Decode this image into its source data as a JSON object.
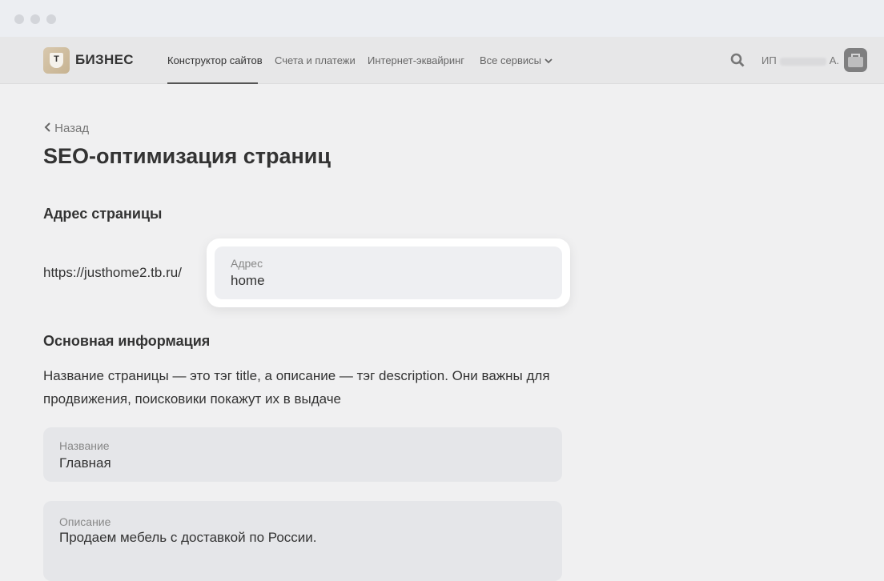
{
  "brand": {
    "logo_letter": "Т",
    "name": "БИЗНЕС"
  },
  "nav": [
    "Конструктор сайтов",
    "Счета и платежи",
    "Интернет-эквайринг",
    "Все сервисы"
  ],
  "user": {
    "prefix": "ИП",
    "suffix": "А."
  },
  "back": "Назад",
  "title": "SEO-оптимизация страниц",
  "address_section": {
    "heading": "Адрес страницы",
    "prefix": "https://justhome2.tb.ru/",
    "label": "Адрес",
    "value": "home"
  },
  "main_section": {
    "heading": "Основная информация",
    "description": "Название страницы — это тэг title, а описание — тэг description. Они важны для продвижения, поисковики покажут их в выдаче",
    "name_label": "Название",
    "name_value": "Главная",
    "desc_label": "Описание",
    "desc_value": "Продаем мебель с доставкой по России."
  }
}
